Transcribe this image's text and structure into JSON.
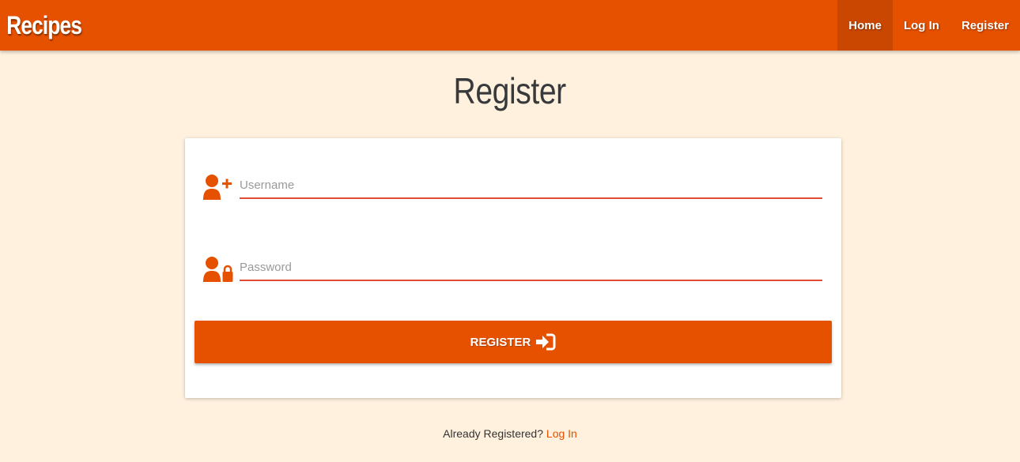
{
  "header": {
    "brand": "Recipes",
    "nav": [
      {
        "label": "Home",
        "active": true
      },
      {
        "label": "Log In",
        "active": false
      },
      {
        "label": "Register",
        "active": false
      }
    ]
  },
  "page": {
    "title": "Register"
  },
  "form": {
    "username": {
      "placeholder": "Username",
      "value": "",
      "icon": "user-plus-icon"
    },
    "password": {
      "placeholder": "Password",
      "value": "",
      "icon": "user-lock-icon"
    },
    "submit": {
      "label": "REGISTER",
      "icon": "sign-in-icon"
    }
  },
  "footer": {
    "prompt": "Already Registered?",
    "link_label": "Log In"
  },
  "colors": {
    "primary": "#e65100",
    "active_nav": "#c94700",
    "background": "#fff1de",
    "input_underline": "#e34b33"
  }
}
